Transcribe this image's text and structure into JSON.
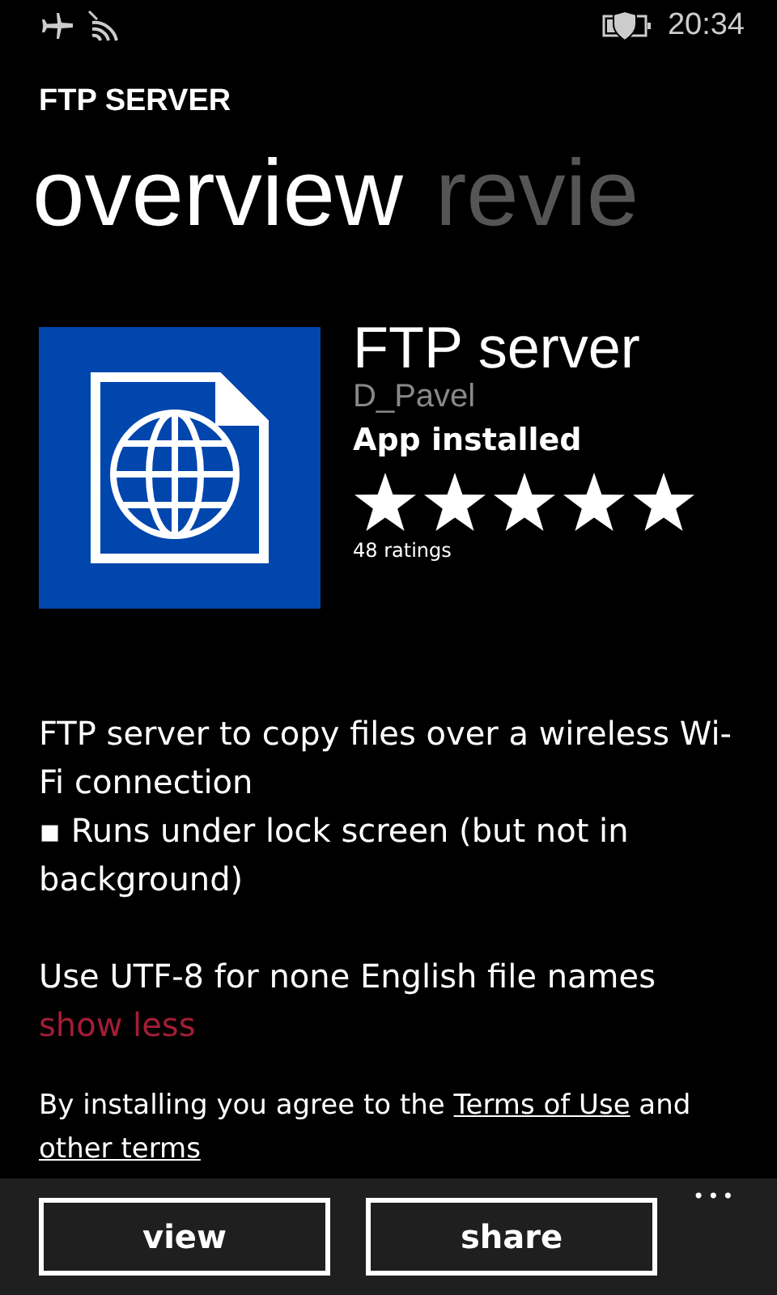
{
  "status_bar": {
    "time": "20:34"
  },
  "app_title": "FTP SERVER",
  "pivots": [
    {
      "label": "overview",
      "selected": true
    },
    {
      "label": "revie",
      "selected": false
    }
  ],
  "app": {
    "name": "FTP server",
    "publisher": "D_Pavel",
    "status": "App installed",
    "stars": 5,
    "ratings": "48 ratings"
  },
  "description": [
    "FTP server to copy files over a wireless Wi-Fi connection",
    "▪ Runs under lock screen (but not in background)",
    "Use UTF-8 for none English file names"
  ],
  "toggle_link": "show less",
  "terms": {
    "before": "By installing you agree to the",
    "link1": "Terms of Use",
    "middle": "and",
    "link2": "other terms"
  },
  "app_bar": {
    "buttons": [
      "view",
      "share"
    ],
    "more": "•••"
  }
}
